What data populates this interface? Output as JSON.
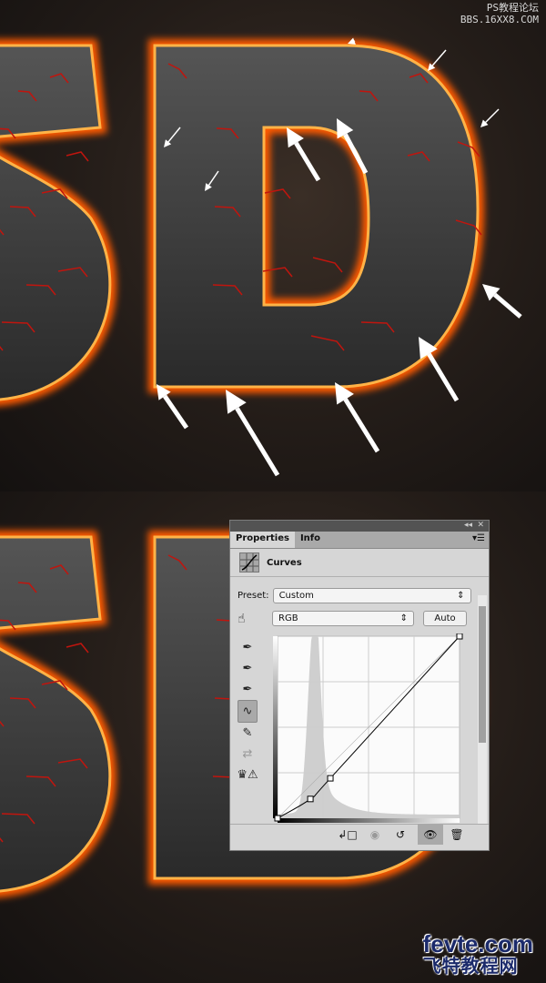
{
  "watermark_top": {
    "line1": "PS教程论坛",
    "line2": "BBS.16XX8.COM"
  },
  "watermark_bottom": {
    "line1": "fevte.com",
    "line2": "飞特教程网"
  },
  "panel": {
    "tabs": [
      {
        "label": "Properties",
        "active": true
      },
      {
        "label": "Info",
        "active": false
      }
    ],
    "collapse_icon": "double-chevron-left-icon",
    "close_icon": "close-icon",
    "menu_icon": "panel-menu-icon",
    "adjustment_title": "Curves",
    "preset_label": "Preset:",
    "preset_value": "Custom",
    "channel_value": "RGB",
    "auto_label": "Auto",
    "tools": [
      "on-image-adjust-icon",
      "black-point-eyedropper-icon",
      "gray-point-eyedropper-icon",
      "white-point-eyedropper-icon",
      "curve-points-icon",
      "pencil-icon",
      "smooth-icon",
      "clipping-warning-icon"
    ],
    "footer_icons": [
      "clip-to-layer-icon",
      "view-previous-icon",
      "reset-icon",
      "visibility-icon",
      "delete-icon"
    ],
    "curve": {
      "input_range": [
        0,
        255
      ],
      "points": [
        [
          0,
          0
        ],
        [
          46,
          27
        ],
        [
          74,
          56
        ],
        [
          255,
          255
        ]
      ]
    }
  },
  "colors": {
    "lava": "#ff6a00",
    "panel_bg": "#d6d6d6",
    "arrow": "#ffffff"
  }
}
